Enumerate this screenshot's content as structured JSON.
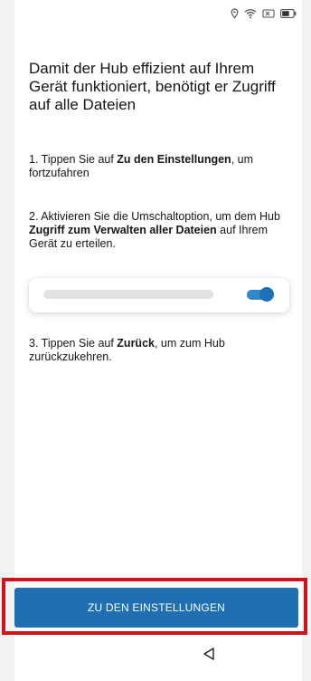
{
  "heading": "Damit der Hub effizient auf Ihrem Gerät funktioniert, benötigt er Zugriff auf alle Dateien",
  "steps": {
    "step1": {
      "prefix": "1. Tippen Sie auf ",
      "bold": "Zu den Einstellungen",
      "suffix": ", um fortzufahren"
    },
    "step2": {
      "prefix": "2. Aktivieren Sie die Umschaltoption, um dem Hub ",
      "bold": "Zugriff zum Verwalten aller Dateien",
      "suffix": " auf Ihrem Gerät zu erteilen."
    },
    "step3": {
      "prefix": "3. Tippen Sie auf ",
      "bold": "Zurück",
      "suffix": ", um zum Hub zurückzukehren."
    }
  },
  "illustration": {
    "toggle_state": "on"
  },
  "cta": {
    "label": "ZU DEN EINSTELLUNGEN"
  },
  "icons": {
    "status": [
      "location-icon",
      "wifi-icon",
      "sim-icon",
      "battery-icon"
    ],
    "nav": [
      "back-triangle-icon"
    ]
  },
  "colors": {
    "primary": "#1f6fb2",
    "highlight": "#d0131b",
    "toggle": "#2f86c9"
  }
}
